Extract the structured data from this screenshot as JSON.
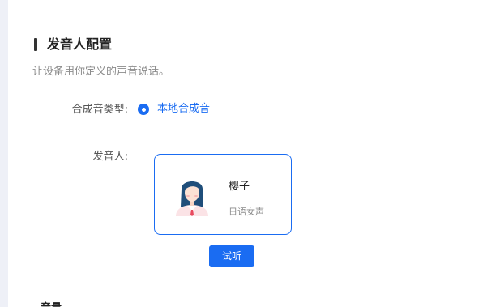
{
  "section": {
    "title": "发音人配置",
    "description": "让设备用你定义的声音说话。"
  },
  "synthesis": {
    "label": "合成音类型:",
    "selected_option": "本地合成音"
  },
  "speaker": {
    "label": "发音人:",
    "name": "樱子",
    "description": "日语女声",
    "avatar_icon": "female-avatar-icon"
  },
  "preview_button": "试听",
  "next_section_title": "音量",
  "colors": {
    "accent": "#1a6cf2",
    "left_strip": "#eef0f7"
  }
}
